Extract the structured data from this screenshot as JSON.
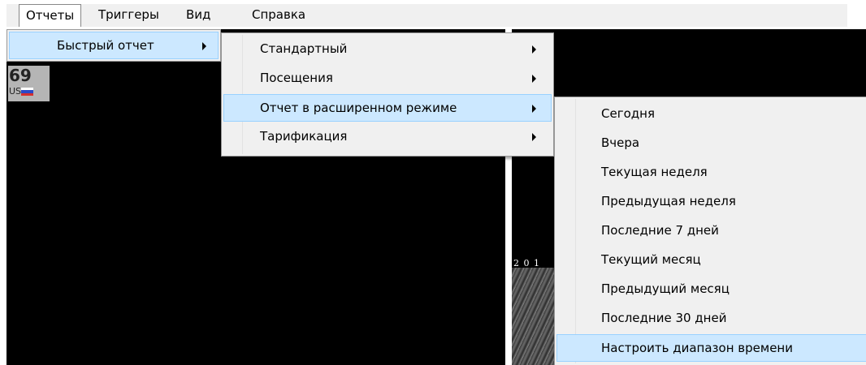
{
  "menubar": {
    "items": [
      {
        "label": "Отчеты"
      },
      {
        "label": "Триггеры"
      },
      {
        "label": "Вид"
      },
      {
        "label": "Справка"
      }
    ]
  },
  "camera_badge": {
    "number": "69",
    "country": "US"
  },
  "camera_overlay": {
    "text": "2 0 1"
  },
  "menu1": {
    "items": [
      {
        "label": "Быстрый отчет"
      }
    ]
  },
  "menu2": {
    "items": [
      {
        "label": "Стандартный"
      },
      {
        "label": "Посещения"
      },
      {
        "label": "Отчет в расширенном режиме"
      },
      {
        "label": "Тарификация"
      }
    ]
  },
  "menu3": {
    "items": [
      {
        "label": "Сегодня"
      },
      {
        "label": "Вчера"
      },
      {
        "label": "Текущая неделя"
      },
      {
        "label": "Предыдущая неделя"
      },
      {
        "label": "Последние 7 дней"
      },
      {
        "label": "Текущий месяц"
      },
      {
        "label": "Предыдущий месяц"
      },
      {
        "label": "Последние 30 дней"
      },
      {
        "label": "Настроить диапазон времени"
      }
    ]
  },
  "colors": {
    "highlight": "#cce8ff",
    "highlight_border": "#99d1ff",
    "menu_background": "#f0f0f0",
    "video_background": "#000000"
  }
}
